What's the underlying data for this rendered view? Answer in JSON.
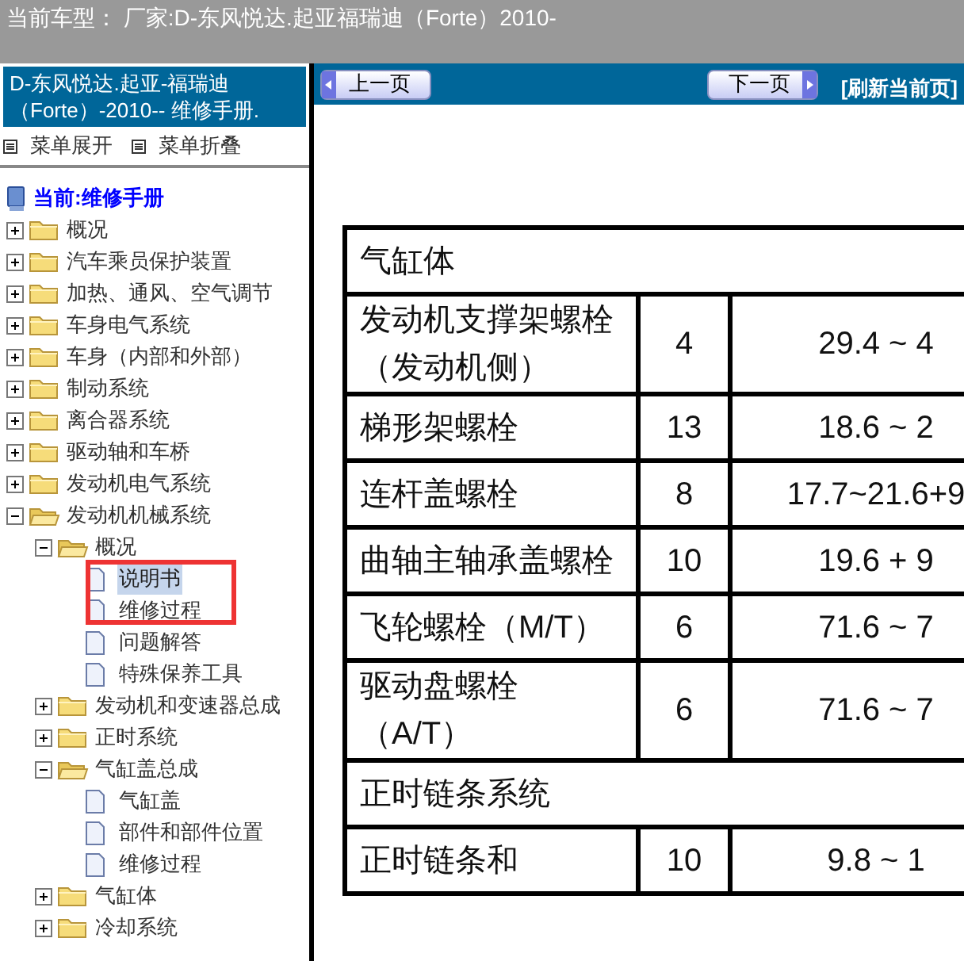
{
  "top_bar": {
    "text": "当前车型：  厂家:D-东风悦达.起亚福瑞迪（Forte）2010-"
  },
  "sidebar": {
    "title": "D-东风悦达.起亚-福瑞迪（Forte）-2010-- 维修手册.",
    "menu_links": [
      "菜单展开",
      "菜单折叠"
    ],
    "current": "当前:维修手册",
    "tree": [
      {
        "label": "概况",
        "expanded": false
      },
      {
        "label": "汽车乘员保护装置",
        "expanded": false
      },
      {
        "label": "加热、通风、空气调节",
        "expanded": false
      },
      {
        "label": "车身电气系统",
        "expanded": false
      },
      {
        "label": "车身（内部和外部）",
        "expanded": false
      },
      {
        "label": "制动系统",
        "expanded": false
      },
      {
        "label": "离合器系统",
        "expanded": false
      },
      {
        "label": "驱动轴和车桥",
        "expanded": false
      },
      {
        "label": "发动机电气系统",
        "expanded": false
      },
      {
        "label": "发动机机械系统",
        "expanded": true,
        "children": [
          {
            "label": "概况",
            "expanded": true,
            "children": [
              {
                "label": "说明书",
                "selected": true
              },
              {
                "label": "维修过程",
                "selected": false
              },
              {
                "label": "问题解答",
                "selected": false
              },
              {
                "label": "特殊保养工具",
                "selected": false
              }
            ]
          },
          {
            "label": "发动机和变速器总成",
            "expanded": false
          },
          {
            "label": "正时系统",
            "expanded": false
          },
          {
            "label": "气缸盖总成",
            "expanded": true,
            "children": [
              {
                "label": "气缸盖",
                "selected": false
              },
              {
                "label": "部件和部件位置",
                "selected": false
              },
              {
                "label": "维修过程",
                "selected": false
              }
            ]
          },
          {
            "label": "气缸体",
            "expanded": false
          },
          {
            "label": "冷却系统",
            "expanded": false
          }
        ]
      }
    ]
  },
  "nav": {
    "prev": "上一页",
    "next": "下一页",
    "refresh": "[刷新当前页]"
  },
  "table": {
    "rows": [
      {
        "kind": "section",
        "cells": [
          {
            "text": "气缸体",
            "colspan": 3
          }
        ]
      },
      {
        "kind": "data",
        "cells": [
          "发动机支撑架螺栓（发动机侧）",
          "4",
          "29.4 ~ 4"
        ]
      },
      {
        "kind": "data",
        "cells": [
          "梯形架螺栓",
          "13",
          "18.6 ~ 2"
        ]
      },
      {
        "kind": "data",
        "cells": [
          "连杆盖螺栓",
          "8",
          "17.7~21.6+9"
        ]
      },
      {
        "kind": "data",
        "cells": [
          "曲轴主轴承盖螺栓",
          "10",
          "19.6 + 9"
        ]
      },
      {
        "kind": "data",
        "cells": [
          "飞轮螺栓（M/T）",
          "6",
          "71.6 ~ 7"
        ]
      },
      {
        "kind": "data",
        "cells": [
          "驱动盘螺栓（A/T）",
          "6",
          "71.6 ~ 7"
        ]
      },
      {
        "kind": "section",
        "cells": [
          {
            "text": "正时链条系统",
            "colspan": 3
          }
        ]
      },
      {
        "kind": "data",
        "cells": [
          "正时链条和",
          "10",
          "9.8 ~ 1"
        ]
      }
    ]
  }
}
